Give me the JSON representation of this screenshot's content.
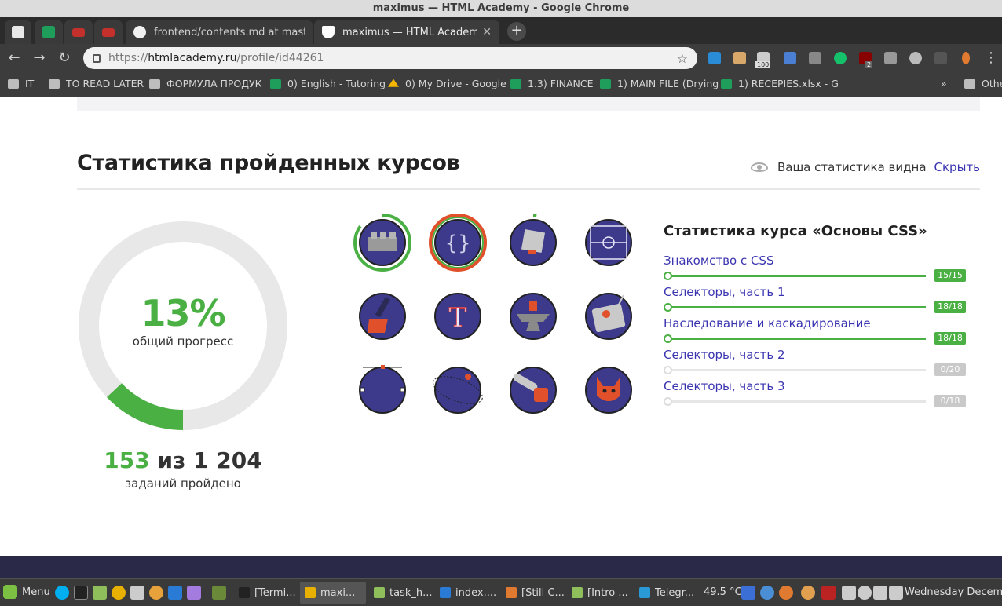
{
  "window": {
    "title": "maximus — HTML Academy - Google Chrome"
  },
  "tabs": [
    {
      "label": "frontend/contents.md at maste",
      "icon": "github-icon"
    },
    {
      "label": "maximus — HTML Academy",
      "icon": "htmlacademy-icon",
      "active": true
    }
  ],
  "toolbar": {
    "url_scheme": "https://",
    "url_host": "htmlacademy.ru",
    "url_path": "/profile/id44261",
    "ext_badge_100": "100",
    "ext_badge_2": "2"
  },
  "bookmarks": [
    {
      "label": "IT",
      "icon": "folder"
    },
    {
      "label": "TO READ LATER",
      "icon": "folder"
    },
    {
      "label": "ФОРМУЛА ПРОДУК",
      "icon": "folder"
    },
    {
      "label": "0) English - Tutoring",
      "icon": "sheet"
    },
    {
      "label": "0) My Drive - Google",
      "icon": "drive"
    },
    {
      "label": "1.3) FINANCE",
      "icon": "sheet"
    },
    {
      "label": "1) MAIN FILE (Drying",
      "icon": "sheet"
    },
    {
      "label": "1) RECEPIES.xlsx - G",
      "icon": "sheet"
    },
    {
      "label": "»",
      "icon": "none"
    },
    {
      "label": "Othe",
      "icon": "folder"
    }
  ],
  "stats": {
    "title": "Статистика пройденных курсов",
    "visibility_text": "Ваша статистика видна",
    "hide_link": "Скрыть",
    "percent": "13%",
    "percent_value": 13,
    "percent_label": "общий прогресс",
    "tasks_done": "153",
    "tasks_sep": "из",
    "tasks_total": "1 204",
    "tasks_label": "заданий пройдено"
  },
  "badges": [
    {
      "icon": "lego-brick-icon",
      "progress": 0.85
    },
    {
      "icon": "curly-braces-icon",
      "progress": 1.0
    },
    {
      "icon": "rubiks-cube-icon",
      "progress": 0.02
    },
    {
      "icon": "football-field-icon",
      "progress": 0
    },
    {
      "icon": "paint-brush-icon",
      "progress": 0
    },
    {
      "icon": "letter-t-icon",
      "progress": 0
    },
    {
      "icon": "anvil-icon",
      "progress": 0
    },
    {
      "icon": "robot-icon",
      "progress": 0
    },
    {
      "icon": "vector-circle-icon",
      "progress": 0
    },
    {
      "icon": "orbit-icon",
      "progress": 0
    },
    {
      "icon": "chainsaw-icon",
      "progress": 0
    },
    {
      "icon": "fox-icon",
      "progress": 0
    }
  ],
  "course": {
    "title": "Статистика курса «Основы CSS»",
    "lessons": [
      {
        "name": "Знакомство с CSS",
        "count": "15/15",
        "progress": 1.0
      },
      {
        "name": "Селекторы, часть 1",
        "count": "18/18",
        "progress": 1.0
      },
      {
        "name": "Наследование и каскадирование",
        "count": "18/18",
        "progress": 1.0
      },
      {
        "name": "Селекторы, часть 2",
        "count": "0/20",
        "progress": 0
      },
      {
        "name": "Селекторы, часть 3",
        "count": "0/18",
        "progress": 0
      }
    ]
  },
  "taskbar": {
    "menu_label": "Menu",
    "windows": [
      "[Termi...",
      "maxi...",
      "task_h...",
      "index....",
      "[Still C...",
      "[Intro ...",
      "Telegr..."
    ],
    "temperature": "49.5 °C",
    "clock": "Wednesday December"
  },
  "colors": {
    "accent_green": "#4ab043",
    "link_purple": "#3a34b0",
    "badge_navy": "#3d3a8c"
  }
}
